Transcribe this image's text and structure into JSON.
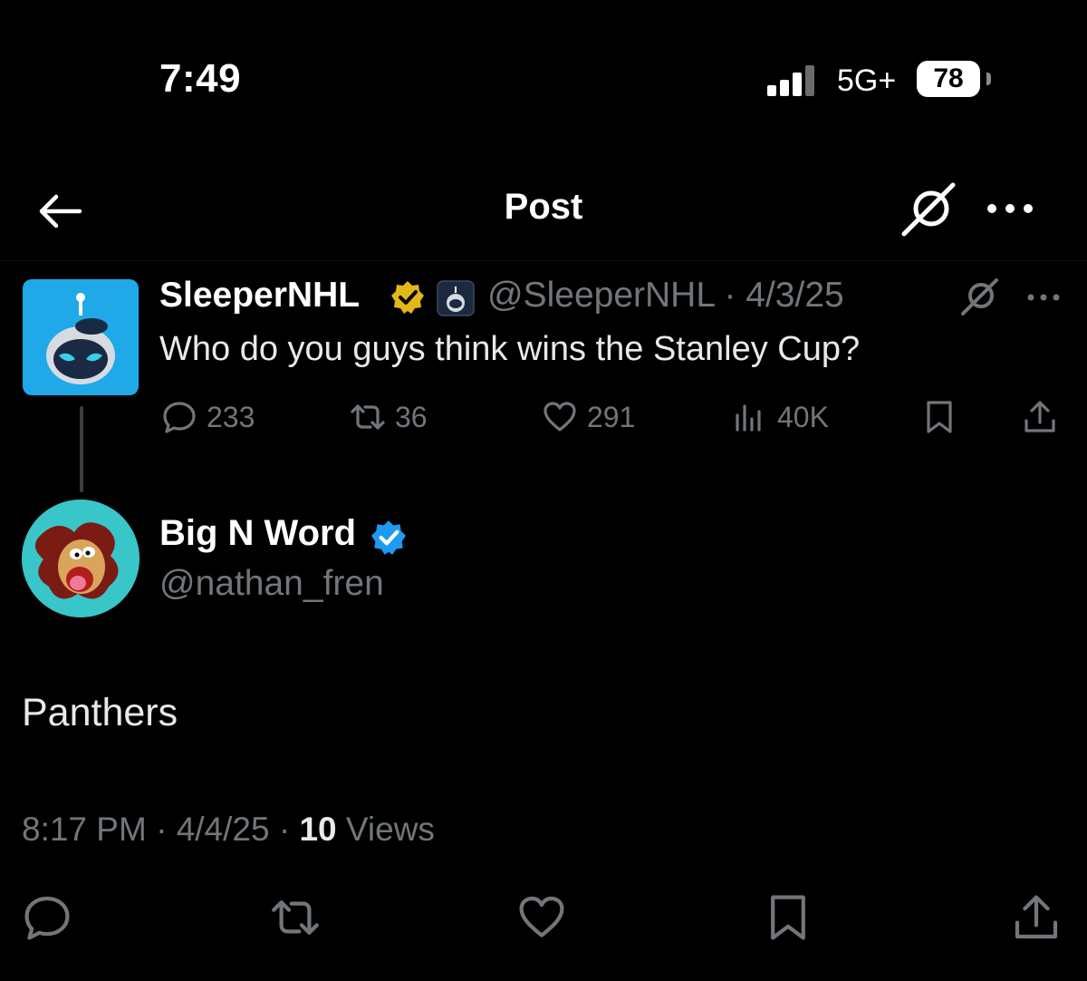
{
  "status_bar": {
    "time": "7:49",
    "network": "5G+",
    "battery": "78",
    "icons": [
      "signal-bars-icon",
      "battery-icon"
    ]
  },
  "header": {
    "title": "Post",
    "icons": [
      "back-arrow-icon",
      "grok-icon",
      "more-icon"
    ]
  },
  "parent_post": {
    "display_name": "SleeperNHL",
    "handle": "@SleeperNHL",
    "separator": "·",
    "date": "4/3/25",
    "text": "Who do you guys think wins the Stanley Cup?",
    "badge": "gold-verified-icon",
    "affiliate_icon": "sleeper-affiliate-icon",
    "actions": {
      "replies": "233",
      "reposts": "36",
      "likes": "291",
      "views": "40K"
    }
  },
  "main_post": {
    "display_name": "Big N Word",
    "handle": "@nathan_fren",
    "badge": "blue-verified-icon",
    "text": "Panthers",
    "time": "8:17 PM",
    "date": "4/4/25",
    "separator": "·",
    "views_count": "10",
    "views_label": "Views"
  },
  "bottom_actions": [
    "reply-icon",
    "repost-icon",
    "like-icon",
    "bookmark-icon",
    "share-icon"
  ],
  "colors": {
    "background": "#000000",
    "text_primary": "#e7e9ea",
    "text_secondary": "#71767b",
    "verified_blue": "#1d9bf0",
    "verified_gold": "#e2b719"
  }
}
